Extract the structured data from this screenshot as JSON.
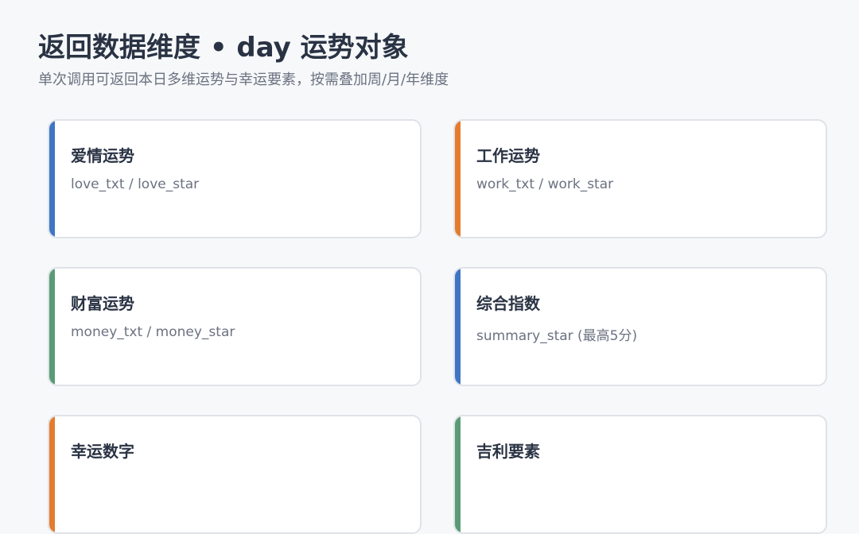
{
  "header": {
    "title": "返回数据维度 • day 运势对象",
    "subtitle": "单次调用可返回本日多维运势与幸运要素，按需叠加周/月/年维度"
  },
  "colors": {
    "blue": "#3f76c4",
    "orange": "#e57b2c",
    "green": "#5a9b75",
    "background": "#f6f8fa",
    "card_border": "#dfe3e8"
  },
  "cards": [
    {
      "title": "爱情运势",
      "desc": "love_txt / love_star",
      "accent": "#3f76c4"
    },
    {
      "title": "工作运势",
      "desc": "work_txt / work_star",
      "accent": "#e57b2c"
    },
    {
      "title": "财富运势",
      "desc": "money_txt / money_star",
      "accent": "#5a9b75"
    },
    {
      "title": "综合指数",
      "desc": "summary_star (最高5分)",
      "accent": "#3f76c4"
    },
    {
      "title": "幸运数字",
      "desc": "",
      "accent": "#e57b2c"
    },
    {
      "title": "吉利要素",
      "desc": "",
      "accent": "#5a9b75"
    }
  ]
}
